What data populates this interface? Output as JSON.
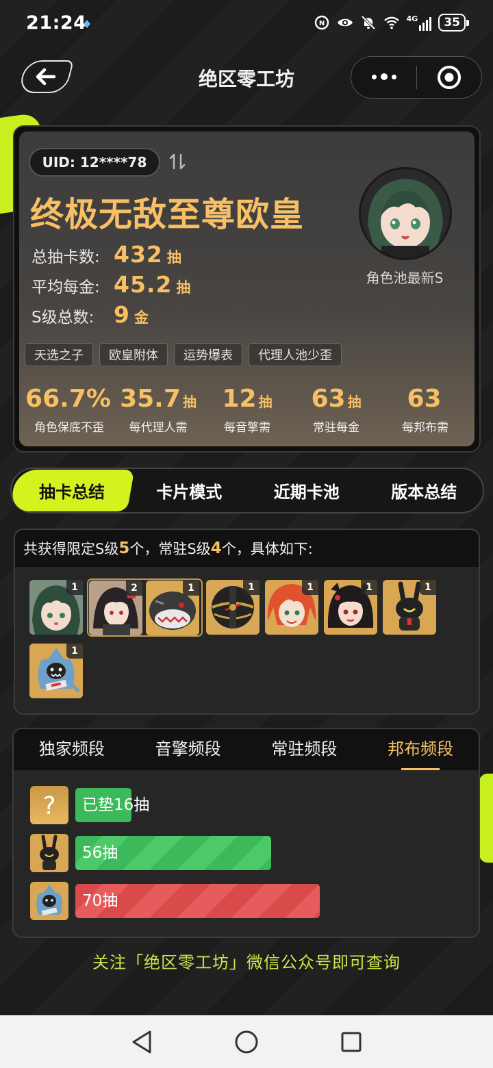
{
  "status_bar": {
    "time": "21:24",
    "network": "4G",
    "battery": "35"
  },
  "header": {
    "title": "绝区零工坊"
  },
  "profile": {
    "uid": "UID: 12****78",
    "rank_title": "终极无敌至尊欧皇",
    "stats": [
      {
        "label": "总抽卡数:",
        "value": "432",
        "unit": "抽"
      },
      {
        "label": "平均每金:",
        "value": "45.2",
        "unit": "抽"
      },
      {
        "label": "S级总数:",
        "value": "9",
        "unit": "金"
      }
    ],
    "avatar_caption": "角色池最新S",
    "tags": [
      "天选之子",
      "欧皇附体",
      "运势爆表",
      "代理人池少歪"
    ],
    "metrics": [
      {
        "value": "66.7%",
        "unit": "",
        "label": "角色保底不歪"
      },
      {
        "value": "35.7",
        "unit": "抽",
        "label": "每代理人需"
      },
      {
        "value": "12",
        "unit": "抽",
        "label": "每音擎需"
      },
      {
        "value": "63",
        "unit": "抽",
        "label": "常驻每金"
      },
      {
        "value": "63",
        "unit": "",
        "label": "每邦布需"
      }
    ]
  },
  "nav_tabs": [
    "抽卡总结",
    "卡片模式",
    "近期卡池",
    "版本总结"
  ],
  "summary": {
    "prefix": "共获得限定S级",
    "limited_count": "5",
    "middle": "个，常驻S级",
    "standard_count": "4",
    "suffix": "个，具体如下:",
    "characters": [
      {
        "icon": "green-hair-girl-portrait",
        "count": "1"
      },
      {
        "icon": "dark-hair-girl-portrait",
        "count": "2"
      },
      {
        "icon": "shark-bangboo-portrait",
        "count": "1"
      },
      {
        "icon": "black-orb-engine-portrait",
        "count": "1"
      },
      {
        "icon": "red-hair-girl-portrait",
        "count": "1"
      },
      {
        "icon": "black-hair-girl-portrait",
        "count": "1"
      },
      {
        "icon": "rabbit-bangboo-portrait",
        "count": "1"
      },
      {
        "icon": "shark-costume-bangboo-portrait",
        "count": "1"
      }
    ]
  },
  "frequency": {
    "tabs": [
      "独家频段",
      "音擎频段",
      "常驻频段",
      "邦布频段"
    ],
    "active_tab": "邦布频段",
    "rows": [
      {
        "icon": "question-mark-icon",
        "label": "已垫16抽",
        "pulls": 16,
        "color": "#3cb95a"
      },
      {
        "icon": "rabbit-bangboo-icon",
        "label": "56抽",
        "pulls": 56,
        "color": "#3cb95a"
      },
      {
        "icon": "shark-bangboo-icon",
        "label": "70抽",
        "pulls": 70,
        "color": "#d94a4a"
      }
    ]
  },
  "footer_note": "关注「绝区零工坊」微信公众号即可查询",
  "colors": {
    "accent_gold": "#f7c064",
    "accent_lime": "#d4f21e",
    "bar_green": "#3cb95a",
    "bar_red": "#d94a4a"
  }
}
